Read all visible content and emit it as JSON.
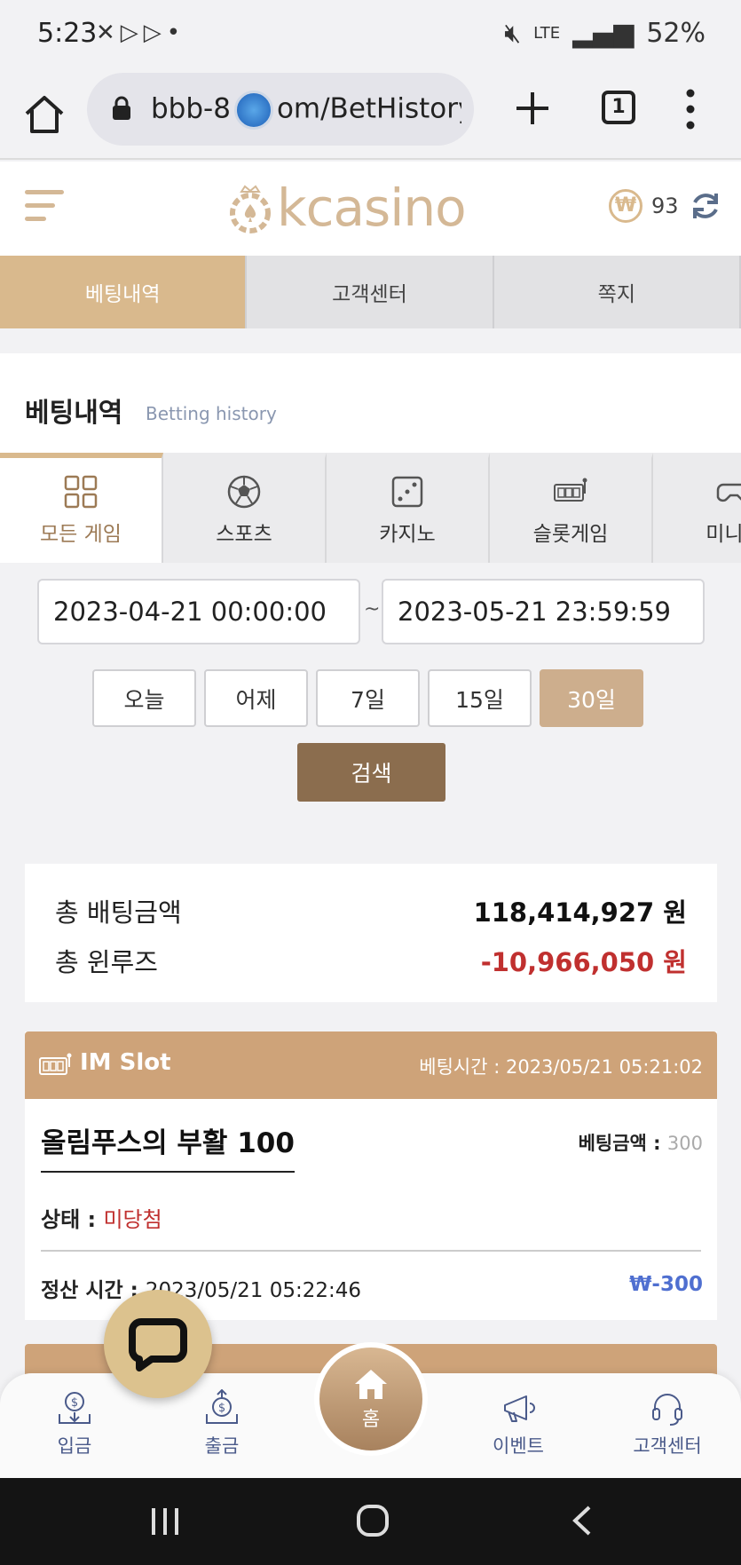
{
  "status_bar": {
    "time": "5:23",
    "network": "LTE",
    "battery": "52%"
  },
  "browser": {
    "url": "bbb-8",
    "url_tail": "om/BetHistory",
    "tab_count": "1"
  },
  "header": {
    "logo_text": "kcasino",
    "currency_symbol": "₩",
    "balance": "93"
  },
  "top_tabs": [
    {
      "label": "베팅내역",
      "active": true
    },
    {
      "label": "고객센터",
      "active": false
    },
    {
      "label": "쪽지",
      "active": false
    }
  ],
  "section": {
    "title_ko": "베팅내역",
    "title_en": "Betting history"
  },
  "game_tabs": [
    {
      "label": "모든 게임",
      "icon": "grid-icon",
      "active": true
    },
    {
      "label": "스포츠",
      "icon": "soccer-ball-icon",
      "active": false
    },
    {
      "label": "카지노",
      "icon": "dice-icon",
      "active": false
    },
    {
      "label": "슬롯게임",
      "icon": "slot-machine-icon",
      "active": false
    },
    {
      "label": "미니게",
      "icon": "gamepad-icon",
      "active": false
    }
  ],
  "date_range": {
    "start": "2023-04-21 00:00:00",
    "separator": "~",
    "end": "2023-05-21 23:59:59"
  },
  "quick_filters": [
    {
      "label": "오늘",
      "active": false
    },
    {
      "label": "어제",
      "active": false
    },
    {
      "label": "7일",
      "active": false
    },
    {
      "label": "15일",
      "active": false
    },
    {
      "label": "30일",
      "active": true
    }
  ],
  "search_label": "검색",
  "totals": {
    "bet_label": "총 배팅금액",
    "bet_value": "118,414,927 원",
    "winloss_label": "총 윈루즈",
    "winloss_value": "-10,966,050 원"
  },
  "bet_card": {
    "provider": "IM Slot",
    "time_label": "베팅시간 : 2023/05/21 05:21:02",
    "game_name": "올림푸스의 부활 100",
    "amount_label": "베팅금액 : ",
    "amount_value": "300",
    "status_label": "상태 : ",
    "status_value": "미당첨",
    "settle_label": "정산 시간 : ",
    "settle_value": "2023/05/21 05:22:46",
    "result": "₩-300"
  },
  "bottom_nav": [
    {
      "label": "입금",
      "icon": "deposit-icon"
    },
    {
      "label": "출금",
      "icon": "withdraw-icon"
    },
    {
      "label": "홈",
      "icon": "home-icon"
    },
    {
      "label": "이벤트",
      "icon": "megaphone-icon"
    },
    {
      "label": "고객센터",
      "icon": "headset-icon"
    }
  ],
  "colors": {
    "accent": "#d9b98d",
    "dark_accent": "#8b6d4e",
    "negative": "#c0302f",
    "result_blue": "#4f6fd0"
  }
}
